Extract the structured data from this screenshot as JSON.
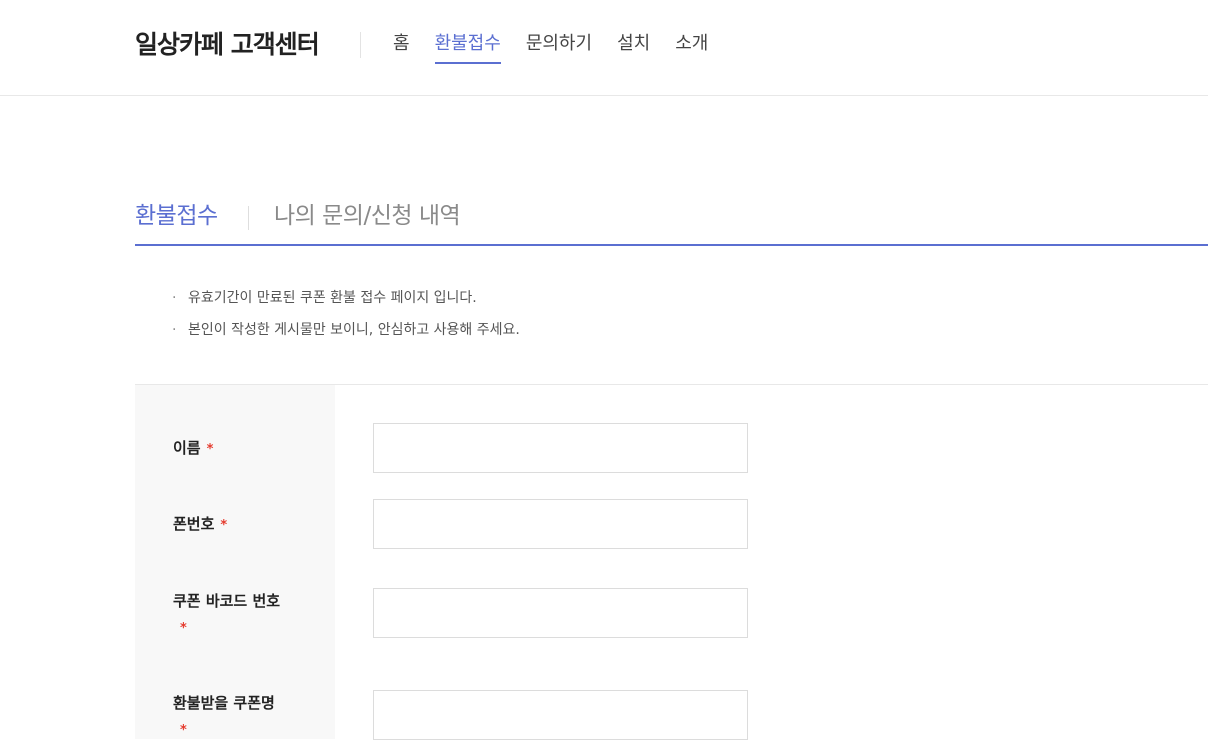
{
  "header": {
    "logo": "일상카페 고객센터",
    "nav": [
      {
        "label": "홈",
        "active": false
      },
      {
        "label": "환불접수",
        "active": true
      },
      {
        "label": "문의하기",
        "active": false
      },
      {
        "label": "설치",
        "active": false
      },
      {
        "label": "소개",
        "active": false
      }
    ]
  },
  "tabs": {
    "active": "환불접수",
    "inactive": "나의 문의/신청 내역"
  },
  "notices": [
    "유효기간이 만료된 쿠폰 환불 접수 페이지 입니다.",
    "본인이 작성한 게시물만 보이니, 안심하고 사용해 주세요."
  ],
  "form": {
    "required_mark": "*",
    "fields": [
      {
        "label": "이름",
        "value": ""
      },
      {
        "label": "폰번호",
        "value": ""
      },
      {
        "label": "쿠폰 바코드 번호",
        "value": ""
      },
      {
        "label": "환불받을 쿠폰명",
        "value": ""
      }
    ]
  },
  "colors": {
    "accent": "#5b6fd1",
    "required": "#e53b2e"
  }
}
